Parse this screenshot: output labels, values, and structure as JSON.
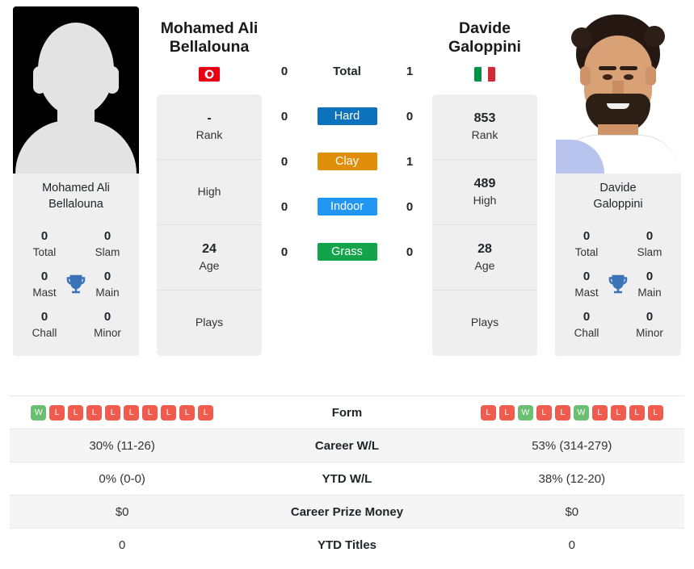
{
  "players": {
    "left": {
      "name": "Mohamed Ali Bellalouna",
      "name_line1": "Mohamed Ali",
      "name_line2": "Bellalouna",
      "caption_line1": "Mohamed Ali",
      "caption_line2": "Bellalouna",
      "country": "Tunisia",
      "flag_icon": "flag-tunisia-icon",
      "photo": "player-photo-placeholder",
      "titles": {
        "total_val": "0",
        "total_lab": "Total",
        "slam_val": "0",
        "slam_lab": "Slam",
        "mast_val": "0",
        "mast_lab": "Mast",
        "main_val": "0",
        "main_lab": "Main",
        "chall_val": "0",
        "chall_lab": "Chall",
        "minor_val": "0",
        "minor_lab": "Minor"
      },
      "info": {
        "rank_val": "-",
        "rank_lab": "Rank",
        "high_val": "",
        "high_lab": "High",
        "age_val": "24",
        "age_lab": "Age",
        "plays_val": "",
        "plays_lab": "Plays"
      }
    },
    "right": {
      "name": "Davide Galoppini",
      "name_line1": "Davide",
      "name_line2": "Galoppini",
      "caption_line1": "Davide",
      "caption_line2": "Galoppini",
      "country": "Italy",
      "flag_icon": "flag-italy-icon",
      "photo": "player-photo",
      "titles": {
        "total_val": "0",
        "total_lab": "Total",
        "slam_val": "0",
        "slam_lab": "Slam",
        "mast_val": "0",
        "mast_lab": "Mast",
        "main_val": "0",
        "main_lab": "Main",
        "chall_val": "0",
        "chall_lab": "Chall",
        "minor_val": "0",
        "minor_lab": "Minor"
      },
      "info": {
        "rank_val": "853",
        "rank_lab": "Rank",
        "high_val": "489",
        "high_lab": "High",
        "age_val": "28",
        "age_lab": "Age",
        "plays_val": "",
        "plays_lab": "Plays"
      }
    }
  },
  "h2h": {
    "rows": [
      {
        "left": "0",
        "label": "Total",
        "right": "1",
        "style": "plain",
        "color": ""
      },
      {
        "left": "0",
        "label": "Hard",
        "right": "0",
        "style": "badge",
        "color": "#0c72bb"
      },
      {
        "left": "0",
        "label": "Clay",
        "right": "1",
        "style": "badge",
        "color": "#df8e09"
      },
      {
        "left": "0",
        "label": "Indoor",
        "right": "0",
        "style": "badge",
        "color": "#2196f3"
      },
      {
        "left": "0",
        "label": "Grass",
        "right": "0",
        "style": "badge",
        "color": "#13a34a"
      }
    ]
  },
  "table": {
    "rows": [
      {
        "label": "Form",
        "type": "form",
        "left_form": [
          "W",
          "L",
          "L",
          "L",
          "L",
          "L",
          "L",
          "L",
          "L",
          "L"
        ],
        "right_form": [
          "L",
          "L",
          "W",
          "L",
          "L",
          "W",
          "L",
          "L",
          "L",
          "L"
        ],
        "left": "",
        "right": "",
        "alt": false
      },
      {
        "label": "Career W/L",
        "type": "text",
        "left": "30% (11-26)",
        "right": "53% (314-279)",
        "alt": true
      },
      {
        "label": "YTD W/L",
        "type": "text",
        "left": "0% (0-0)",
        "right": "38% (12-20)",
        "alt": false
      },
      {
        "label": "Career Prize Money",
        "type": "text",
        "left": "$0",
        "right": "$0",
        "alt": true
      },
      {
        "label": "YTD Titles",
        "type": "text",
        "left": "0",
        "right": "0",
        "alt": false
      }
    ]
  },
  "colors": {
    "win_badge": "#6bbf73",
    "loss_badge": "#ef5b4c",
    "hard": "#0c72bb",
    "clay": "#df8e09",
    "indoor": "#2196f3",
    "grass": "#13a34a",
    "trophy": "#3b73b9",
    "panel": "#efefef"
  }
}
